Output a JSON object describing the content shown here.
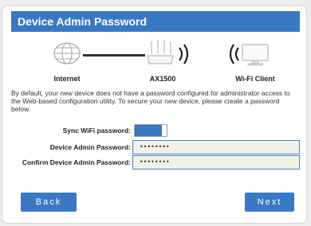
{
  "header": {
    "title": "Device Admin Password"
  },
  "diagram": {
    "internet_label": "Internet",
    "router_label": "AX1500",
    "client_label": "Wi-Fi Client"
  },
  "description": "By default, your new device does not have a password configured for administrator access to the Web-based configuration utility. To secure your new device, please create a password below.",
  "form": {
    "sync_label": "Sync WiFi password:",
    "sync_on": true,
    "admin_label": "Device Admin Password:",
    "admin_value": "••••••••",
    "confirm_label": "Confirm Device Admin Password:",
    "confirm_value": "••••••••"
  },
  "buttons": {
    "back": "Back",
    "next": "Next"
  },
  "colors": {
    "accent": "#3a78c4",
    "field_bg": "#f0f2e6"
  }
}
